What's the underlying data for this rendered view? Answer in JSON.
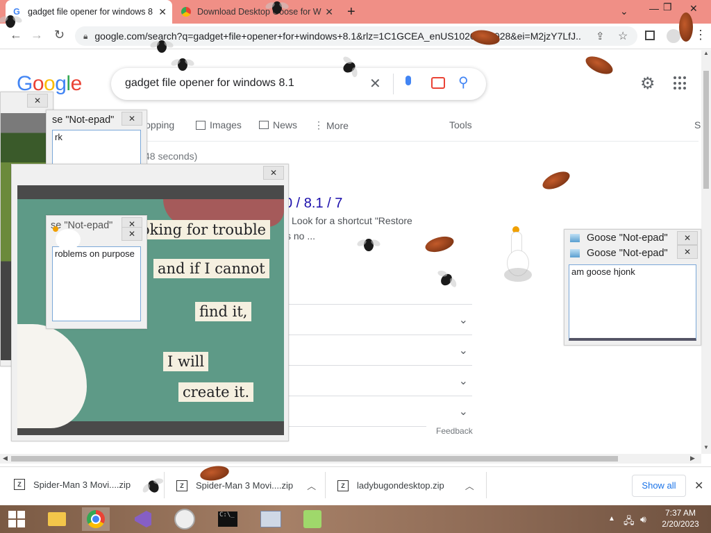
{
  "browser": {
    "tabs": [
      {
        "title": "gadget file opener for windows 8",
        "active": true
      },
      {
        "title": "Download Desktop Goose for W",
        "active": false
      }
    ],
    "new_tab": "+",
    "url": "google.com/search?q=gadget+file+opener+for+windows+8.1&rlz=1C1GCEA_enUS1020US1028&ei=M2jzY7LfJ..."
  },
  "google": {
    "logo": "Google",
    "query": "gadget file opener for windows 8.1",
    "tabs": [
      "Shopping",
      "Images",
      "News",
      "More"
    ],
    "tools": "Tools",
    "safesearch_partial": "S",
    "stats_partial": "48 seconds)",
    "result_title_partial": "0 / 8.1 / 7",
    "result_snippet_line1": "Look for a shortcut \"Restore",
    "result_snippet_line2": "s no ...",
    "feedback": "Feedback"
  },
  "goose_windows": {
    "title": "Goose \"Not-epad\"",
    "title_partial": "se \"Not-epad\"",
    "text_right": "am goose hjonk",
    "text_left_top": "rk",
    "text_left_mid": "roblems on purpose",
    "close": "✕"
  },
  "meme": {
    "lines": [
      "oking for trouble",
      "and if I cannot",
      "find it,",
      "I will",
      "create it."
    ]
  },
  "downloads": {
    "items": [
      "Spider-Man 3 Movi....zip",
      "Spider-Man 3 Movi....zip",
      "ladybugondesktop.zip"
    ],
    "show_all": "Show all"
  },
  "taskbar": {
    "time": "7:37 AM",
    "date": "2/20/2023"
  },
  "colors": {
    "tabstrip": "#f08f86",
    "google_blue": "#4285f4",
    "link_blue": "#1a0dab",
    "meme_green": "#5e9a87"
  }
}
